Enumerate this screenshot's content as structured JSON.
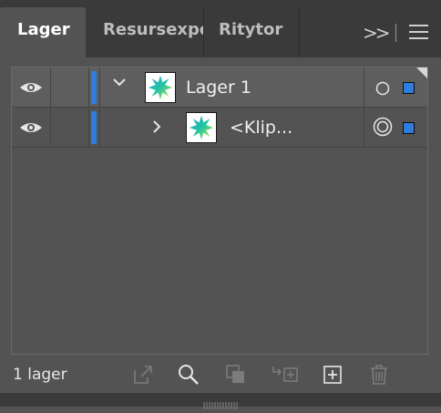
{
  "tabs": [
    {
      "label": "Lager",
      "active": true
    },
    {
      "label": "Resursexport",
      "active": false
    },
    {
      "label": "Ritytor",
      "active": false
    }
  ],
  "tabbar": {
    "overflow_label": ">>"
  },
  "layers": [
    {
      "name": "Lager 1",
      "visible": true,
      "expanded": true,
      "layer_color": "#2f7de0",
      "target": "circle"
    },
    {
      "name": "<Klip...",
      "visible": true,
      "expanded": false,
      "layer_color": "#2f7de0",
      "target": "double-circle"
    }
  ],
  "footer": {
    "count_label": "1 lager",
    "icons": [
      "export-icon",
      "search-icon",
      "clipping-mask-icon",
      "move-to-layer-icon",
      "new-layer-icon",
      "delete-icon"
    ]
  },
  "colors": {
    "selection": "#2f7de0",
    "panel": "#535353",
    "tabbar": "#3a3a3a"
  }
}
